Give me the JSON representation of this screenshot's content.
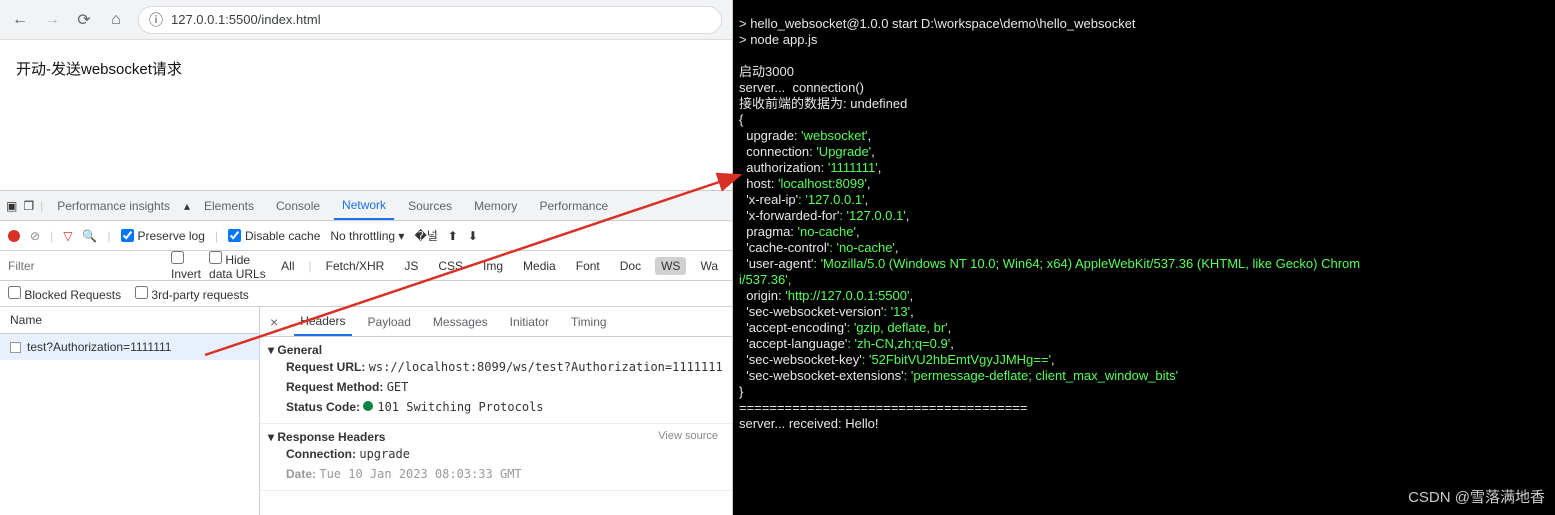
{
  "browser": {
    "url": "127.0.0.1:5500/index.html"
  },
  "page": {
    "text": "开动-发送websocket请求"
  },
  "devtools": {
    "tabs": {
      "insights": "Performance insights",
      "elements": "Elements",
      "console": "Console",
      "network": "Network",
      "sources": "Sources",
      "memory": "Memory",
      "performance": "Performance"
    },
    "toolbar": {
      "preserve_log": "Preserve log",
      "disable_cache": "Disable cache",
      "throttling": "No throttling"
    },
    "filterbar": {
      "placeholder": "Filter",
      "invert": "Invert",
      "hide_data_urls": "Hide data URLs",
      "types": {
        "all": "All",
        "fetchxhr": "Fetch/XHR",
        "js": "JS",
        "css": "CSS",
        "img": "Img",
        "media": "Media",
        "font": "Font",
        "doc": "Doc",
        "ws": "WS",
        "wasm": "Wa"
      }
    },
    "optrow": {
      "blocked": "Blocked Requests",
      "third": "3rd-party requests"
    },
    "reqlist": {
      "header": "Name",
      "item": "test?Authorization=1111111"
    },
    "detail": {
      "tabs": {
        "headers": "Headers",
        "payload": "Payload",
        "messages": "Messages",
        "initiator": "Initiator",
        "timing": "Timing"
      },
      "general": {
        "title": "General",
        "url_label": "Request URL:",
        "url": "ws://localhost:8099/ws/test?Authorization=1111111",
        "method_label": "Request Method:",
        "method": "GET",
        "status_label": "Status Code:",
        "status": "101 Switching Protocols"
      },
      "response_headers": {
        "title": "Response Headers",
        "view_source": "View source",
        "connection_label": "Connection:",
        "connection": "upgrade",
        "date_label": "Date:",
        "date": "Tue  10 Jan 2023 08:03:33 GMT"
      }
    }
  },
  "terminal": {
    "lines": [
      {
        "t": "w",
        "s": ""
      },
      {
        "t": "w",
        "s": "> hello_websocket@1.0.0 start D:\\workspace\\demo\\hello_websocket"
      },
      {
        "t": "w",
        "s": "> node app.js"
      },
      {
        "t": "w",
        "s": ""
      },
      {
        "t": "w",
        "s": "启动3000"
      },
      {
        "t": "w",
        "s": "server...  connection()"
      },
      {
        "t": "w",
        "s": "接收前端的数据为: undefined"
      },
      {
        "t": "w",
        "s": "{"
      },
      {
        "t": "kv",
        "k": "  upgrade: ",
        "v": "'websocket'",
        "c": ","
      },
      {
        "t": "kv",
        "k": "  connection: ",
        "v": "'Upgrade'",
        "c": ","
      },
      {
        "t": "kv",
        "k": "  authorization: ",
        "v": "'1111111'",
        "c": ","
      },
      {
        "t": "kv",
        "k": "  host: ",
        "v": "'localhost:8099'",
        "c": ","
      },
      {
        "t": "kv",
        "k": "  'x-real-ip'",
        "v": ": '127.0.0.1'",
        "c": ","
      },
      {
        "t": "kv",
        "k": "  'x-forwarded-for'",
        "v": ": '127.0.0.1'",
        "c": ","
      },
      {
        "t": "kv",
        "k": "  pragma: ",
        "v": "'no-cache'",
        "c": ","
      },
      {
        "t": "kv",
        "k": "  'cache-control'",
        "v": ": 'no-cache'",
        "c": ","
      },
      {
        "t": "kv",
        "k": "  'user-agent'",
        "v": ": 'Mozilla/5.0 (Windows NT 10.0; Win64; x64) AppleWebKit/537.36 (KHTML, like Gecko) Chrom",
        "c": ""
      },
      {
        "t": "g",
        "s": "i/537.36',"
      },
      {
        "t": "kv",
        "k": "  origin: ",
        "v": "'http://127.0.0.1:5500'",
        "c": ","
      },
      {
        "t": "kv",
        "k": "  'sec-websocket-version'",
        "v": ": '13'",
        "c": ","
      },
      {
        "t": "kv",
        "k": "  'accept-encoding'",
        "v": ": 'gzip, deflate, br'",
        "c": ","
      },
      {
        "t": "kv",
        "k": "  'accept-language'",
        "v": ": 'zh-CN,zh;q=0.9'",
        "c": ","
      },
      {
        "t": "kv",
        "k": "  'sec-websocket-key'",
        "v": ": '52FbitVU2hbEmtVgyJJMHg=='",
        "c": ","
      },
      {
        "t": "kv",
        "k": "  'sec-websocket-extensions'",
        "v": ": 'permessage-deflate; client_max_window_bits'",
        "c": ""
      },
      {
        "t": "w",
        "s": "}"
      },
      {
        "t": "w",
        "s": "======================================"
      },
      {
        "t": "w",
        "s": "server... received: Hello!"
      }
    ]
  },
  "watermark": "CSDN @雪落满地香"
}
